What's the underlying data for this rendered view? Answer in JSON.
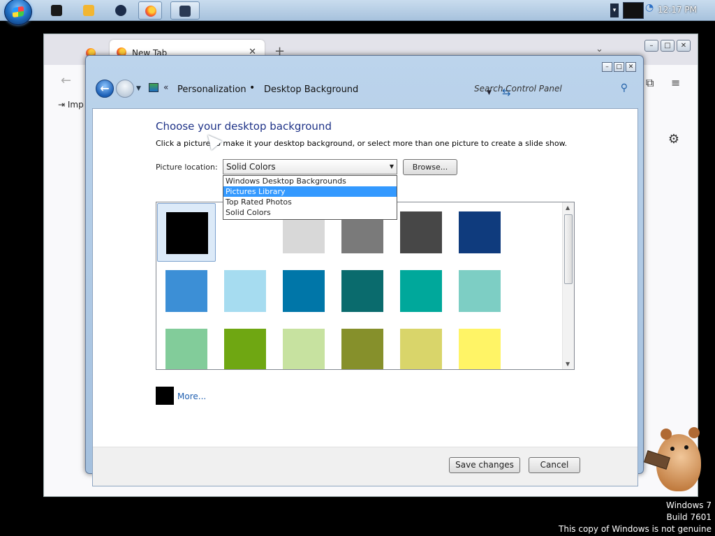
{
  "taskbar": {
    "clock": "12:17 PM",
    "buttons": [
      {
        "icon": "console-icon",
        "color": "#1a1a1a"
      },
      {
        "icon": "media-player-icon",
        "color": "#f2b632"
      },
      {
        "icon": "settings-app-icon",
        "color": "#1b2c4a"
      },
      {
        "icon": "firefox-icon",
        "color": "#ff6a1a"
      },
      {
        "icon": "monitor-app-icon",
        "color": "#2a3a55"
      }
    ]
  },
  "browser": {
    "tab_title": "New Tab",
    "tab_close": "✕",
    "new_tab": "+",
    "bookmark": "Imp"
  },
  "cp": {
    "breadcrumb_1": "Personalization",
    "breadcrumb_2": "Desktop Background",
    "search_placeholder": "Search Control Panel",
    "title": "Choose your desktop background",
    "description": "Click a picture to make it your desktop background, or select more than one picture to create a slide show.",
    "location_label": "Picture location:",
    "location_value": "Solid Colors",
    "browse": "Browse...",
    "dropdown_options": [
      "Windows Desktop Backgrounds",
      "Pictures Library",
      "Top Rated Photos",
      "Solid Colors"
    ],
    "highlighted_option": "Pictures Library",
    "swatches": [
      "#000000",
      "#ffffff",
      "#d8d8d8",
      "#7a7a7a",
      "#474747",
      "#0f3b7d",
      "#3c8fd6",
      "#a6dcf0",
      "#0076a8",
      "#0a6b6d",
      "#00a89b",
      "#7dcec4",
      "#82cc9a",
      "#6fa712",
      "#c7e2a0",
      "#86902b",
      "#d9d56a",
      "#fff466"
    ],
    "selected_swatch": "#000000",
    "more_link": "More...",
    "more_color": "#000000",
    "save": "Save changes",
    "cancel": "Cancel"
  },
  "watermark": {
    "line1": "Windows 7",
    "line2": "Build 7601",
    "line3": "This copy of Windows is not genuine"
  }
}
